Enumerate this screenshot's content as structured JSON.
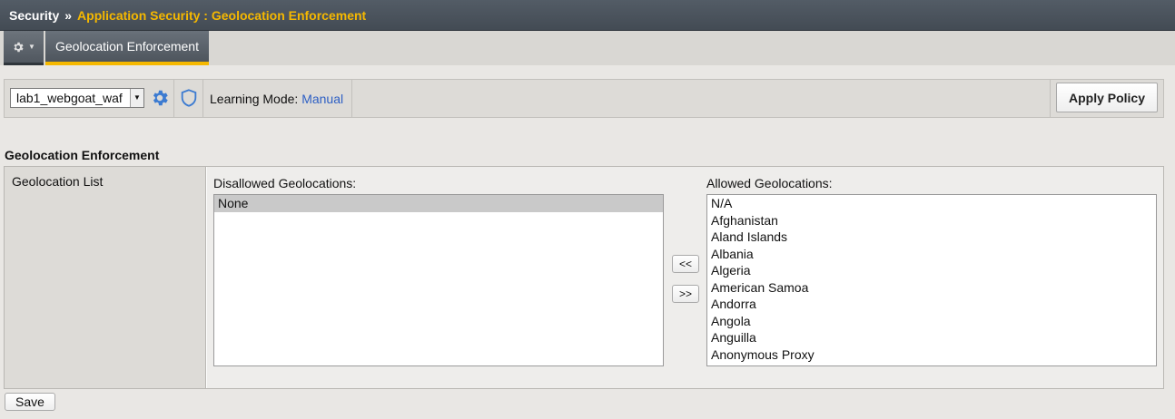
{
  "breadcrumb": {
    "root": "Security",
    "separator": "»",
    "current": "Application Security : Geolocation Enforcement"
  },
  "tabs": {
    "menu_icon": "gear-icon",
    "active_label": "Geolocation Enforcement"
  },
  "policy_bar": {
    "selected_policy": "lab1_webgoat_waf",
    "settings_icon": "gear-icon",
    "policy_icon": "shield-icon",
    "learning_mode_label": "Learning Mode:",
    "learning_mode_value": "Manual",
    "apply_label": "Apply Policy"
  },
  "section": {
    "title": "Geolocation Enforcement",
    "row_label": "Geolocation List",
    "disallowed_caption": "Disallowed Geolocations:",
    "allowed_caption": "Allowed Geolocations:",
    "disallowed": [
      "None"
    ],
    "allowed": [
      "N/A",
      "Afghanistan",
      "Aland Islands",
      "Albania",
      "Algeria",
      "American Samoa",
      "Andorra",
      "Angola",
      "Anguilla",
      "Anonymous Proxy"
    ],
    "move_left_label": "<<",
    "move_right_label": ">>"
  },
  "footer": {
    "save_label": "Save"
  },
  "colors": {
    "accent": "#f5b800",
    "link": "#2d5fc4",
    "header_bg": "#4a525b"
  }
}
